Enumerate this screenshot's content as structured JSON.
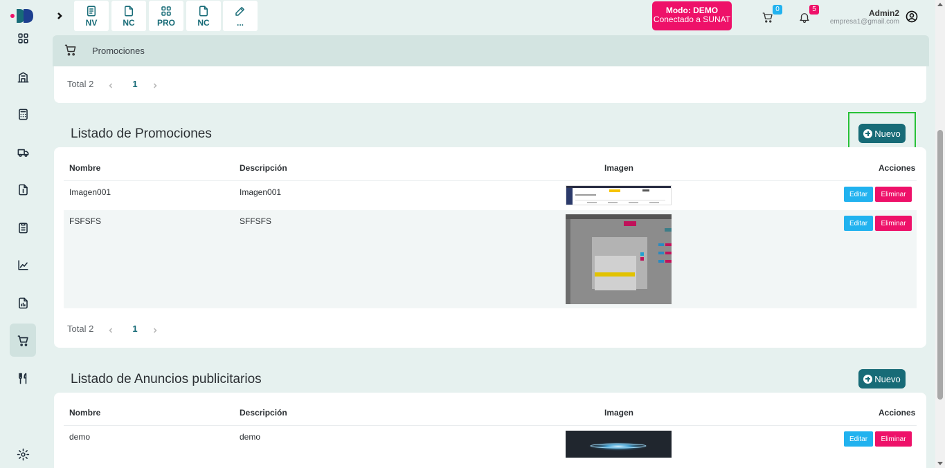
{
  "topbar": {
    "quick_buttons": [
      {
        "label": "NV",
        "icon": "document-list-icon"
      },
      {
        "label": "NC",
        "icon": "document-icon"
      },
      {
        "label": "PRO",
        "icon": "grid-icon"
      },
      {
        "label": "NC",
        "icon": "document-icon"
      },
      {
        "label": "...",
        "icon": "edit-icon"
      }
    ],
    "mode_title": "Modo: DEMO",
    "mode_subtitle": "Conectado a SUNAT",
    "cart_count": "0",
    "notif_count": "5",
    "user_name": "Admin2",
    "user_email": "empresa1@gmail.com"
  },
  "breadcrumb": {
    "label": "Promociones"
  },
  "top_pager": {
    "total": "Total 2",
    "page": "1"
  },
  "promociones": {
    "title": "Listado de Promociones",
    "new_button": "Nuevo",
    "columns": [
      "Nombre",
      "Descripción",
      "Imagen",
      "Acciones"
    ],
    "rows": [
      {
        "nombre": "Imagen001",
        "descripcion": "Imagen001"
      },
      {
        "nombre": "FSFSFS",
        "descripcion": "SFFSFS"
      }
    ],
    "edit_label": "Editar",
    "delete_label": "Eliminar",
    "pager": {
      "total": "Total 2",
      "page": "1"
    }
  },
  "anuncios": {
    "title": "Listado de Anuncios publicitarios",
    "new_button": "Nuevo",
    "columns": [
      "Nombre",
      "Descripción",
      "Imagen",
      "Acciones"
    ],
    "rows": [
      {
        "nombre": "demo",
        "descripcion": "demo"
      }
    ],
    "edit_label": "Editar",
    "delete_label": "Eliminar"
  },
  "colors": {
    "accent": "#176b77",
    "danger": "#ee1169",
    "info": "#21b2ef",
    "highlight": "#27c137"
  }
}
